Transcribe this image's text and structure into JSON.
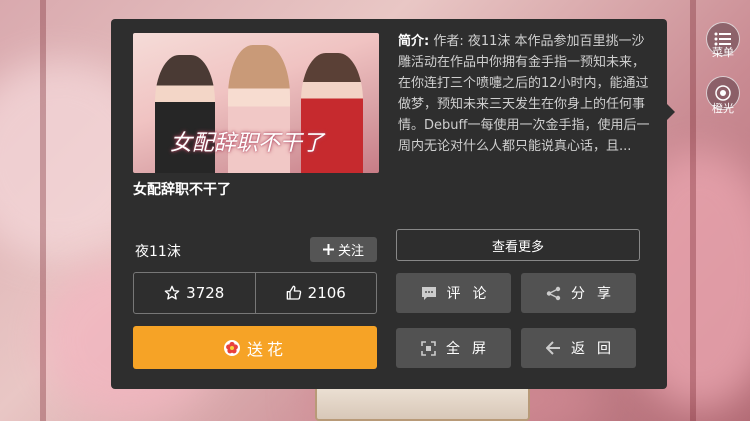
{
  "book": {
    "cover_title": "女配辞职不干了",
    "title": "女配辞职不干了",
    "author": "夜11沫",
    "follow_label": "关注",
    "stars": "3728",
    "likes": "2106",
    "flower_label": "送花",
    "intro_label": "简介:",
    "intro_text": "作者: 夜11沫 本作品参加百里挑一沙雕活动在作品中你拥有金手指一预知未来，在你连打三个喷嚏之后的12小时内，能通过做梦，预知未来三天发生在你身上的任何事情。Debuff一每使用一次金手指，使用后一周内无论对什么人都只能说真心话，且..."
  },
  "actions": {
    "more": "查看更多",
    "comment": "评论",
    "share": "分享",
    "fullscreen": "全屏",
    "back": "返回"
  },
  "side_menu": {
    "menu_label": "菜单",
    "skin_label": "橙光"
  },
  "colors": {
    "panel_bg": "#2e2e2e",
    "button_bg": "#525252",
    "accent_orange": "#f6a326"
  }
}
